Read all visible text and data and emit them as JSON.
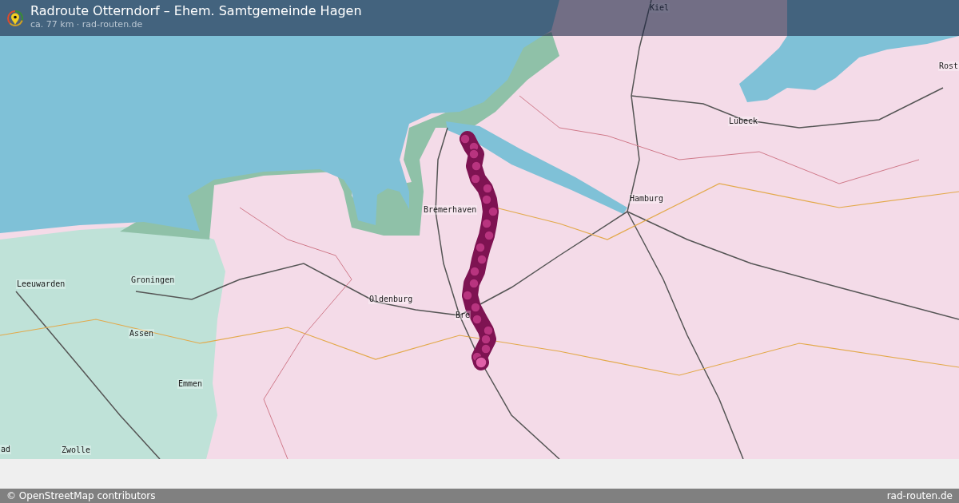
{
  "header": {
    "title": "Radroute Otterndorf – Ehem. Samtgemeinde Hagen",
    "subtitle": "ca. 77 km · rad-routen.de"
  },
  "map": {
    "labels": [
      "Kiel",
      "Rost",
      "Lübeck",
      "Hamburg",
      "Bremerhaven",
      "Oldenburg",
      "Bre",
      "Leeuwarden",
      "Groningen",
      "Assen",
      "Emmen",
      "Zwolle",
      "ad"
    ]
  },
  "footer": {
    "attribution": "© OpenStreetMap contributors",
    "site": "rad-routen.de"
  }
}
